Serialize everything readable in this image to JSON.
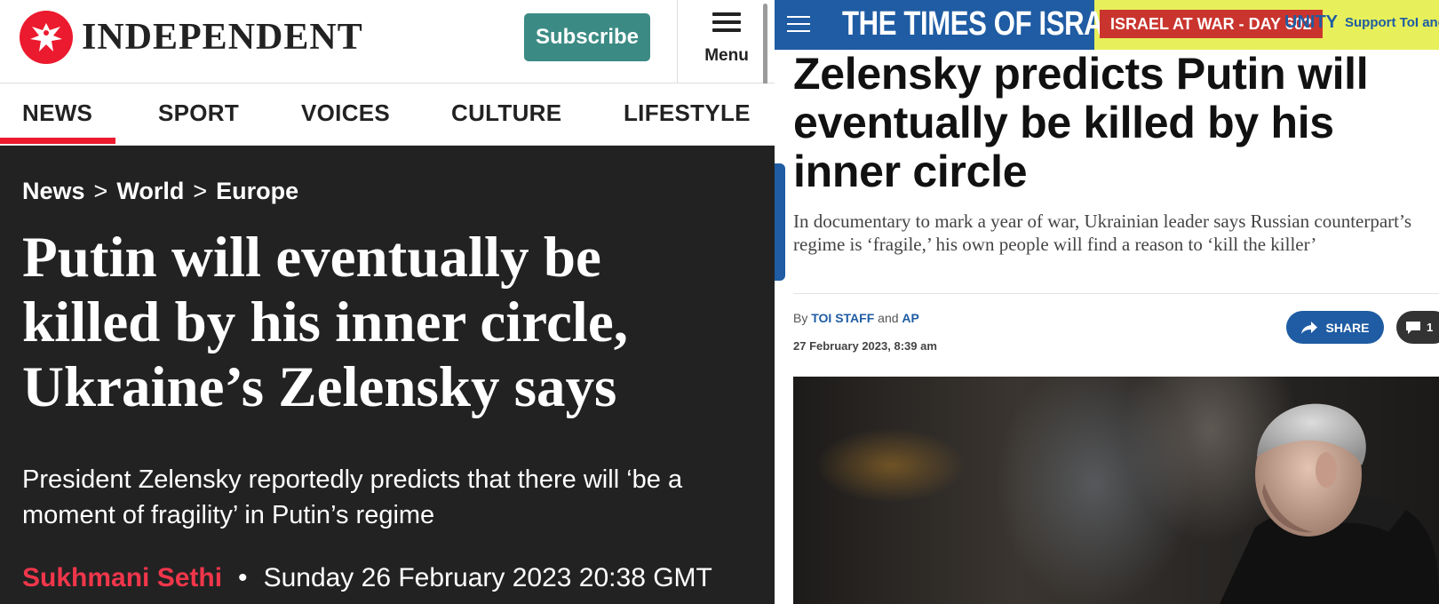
{
  "independent": {
    "logo_text": "INDEPENDENT",
    "subscribe_label": "Subscribe",
    "menu_label": "Menu",
    "nav": [
      "NEWS",
      "SPORT",
      "VOICES",
      "CULTURE",
      "LIFESTYLE"
    ],
    "active_nav": "NEWS",
    "breadcrumb": [
      "News",
      "World",
      "Europe"
    ],
    "breadcrumb_separator": ">",
    "headline": "Putin will eventually be killed by his inner circle, Ukraine’s Zelensky says",
    "standfirst": "President Zelensky reportedly predicts that there will ‘be a moment of fragility’ in Putin’s regime",
    "author": "Sukhmani Sethi",
    "byline_separator": "•",
    "date": "Sunday 26 February 2023 20:38 GMT",
    "colors": {
      "brand_red": "#ec1a2e",
      "subscribe_teal": "#3b8b84",
      "article_bg": "#222223"
    }
  },
  "toi": {
    "masthead": "THE TIMES OF ISRAEL",
    "war_badge": "ISRAEL AT WAR - DAY 602",
    "unity_text": "UNITY",
    "support_text": "Support ToI and",
    "headline": "Zelensky predicts Putin will eventually be killed by his inner circle",
    "subheadline": "In documentary to mark a year of war, Ukrainian leader says Russian counterpart’s regime is ‘fragile,’ his own people will find a reason to ‘kill the killer’",
    "byline_prefix": "By",
    "author1": "TOI STAFF",
    "byline_join": "and",
    "author2": "AP",
    "date": "27 February 2023, 8:39 am",
    "share_label": "SHARE",
    "comment_count": "1",
    "colors": {
      "brand_blue": "#1f5ca3",
      "badge_red": "#c9352e",
      "banner_yellow": "#e7f05a"
    }
  }
}
